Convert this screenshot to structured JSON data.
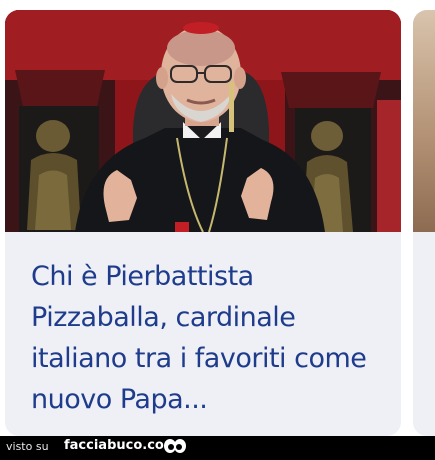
{
  "article": {
    "headline": "Chi è Pierbattista Pizzaballa, cardinale italiano tra i favoriti come nuovo Papa...",
    "image_subject": "cardinal-portrait-photo"
  },
  "footer": {
    "visto_label": "visto su",
    "site_label": "facciabuco.com",
    "logo_icon": "eyes-logo-icon"
  },
  "colors": {
    "headline": "#1f3c8c",
    "card_background": "#eef0f5",
    "footer_background": "#000000",
    "photo_background": "#8a1418"
  }
}
